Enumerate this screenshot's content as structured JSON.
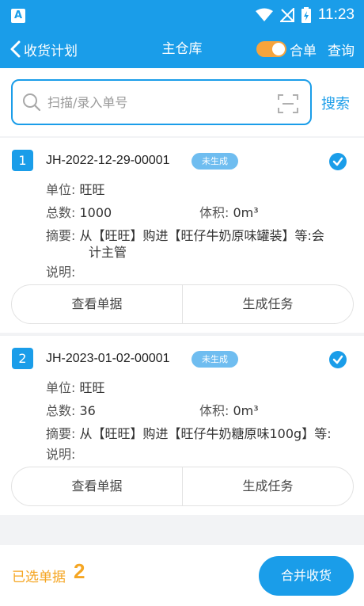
{
  "status_bar": {
    "app_letter": "A",
    "time": "11:23"
  },
  "header": {
    "back_label": "收货计划",
    "title": "主仓库",
    "merge_label": "合单",
    "query_label": "查询"
  },
  "search": {
    "placeholder": "扫描/录入单号",
    "value": "",
    "button_label": "搜索"
  },
  "orders": [
    {
      "index": "1",
      "code": "JH-2022-12-29-00001",
      "badge": "未生成",
      "unit_label": "单位:",
      "unit": "旺旺",
      "total_label": "总数:",
      "total": "1000",
      "volume_label": "体积:",
      "volume": "0m³",
      "summary_label": "摘要:",
      "summary_line1": "从【旺旺】购进【旺仔牛奶原味罐装】等:会",
      "summary_line2": "计主管",
      "note_label": "说明:",
      "view_label": "查看单据",
      "task_label": "生成任务",
      "selected": true
    },
    {
      "index": "2",
      "code": "JH-2023-01-02-00001",
      "badge": "未生成",
      "unit_label": "单位:",
      "unit": "旺旺",
      "total_label": "总数:",
      "total": "36",
      "volume_label": "体积:",
      "volume": "0m³",
      "summary_label": "摘要:",
      "summary_line1": "从【旺旺】购进【旺仔牛奶糖原味100g】等:",
      "note_label": "说明:",
      "view_label": "查看单据",
      "task_label": "生成任务",
      "selected": true
    }
  ],
  "footer": {
    "selected_label": "已选单据",
    "selected_count": "2",
    "merge_button": "合并收货"
  },
  "colors": {
    "primary": "#1a9de9",
    "accent": "#f5a623",
    "badge": "#6fbdf0"
  }
}
